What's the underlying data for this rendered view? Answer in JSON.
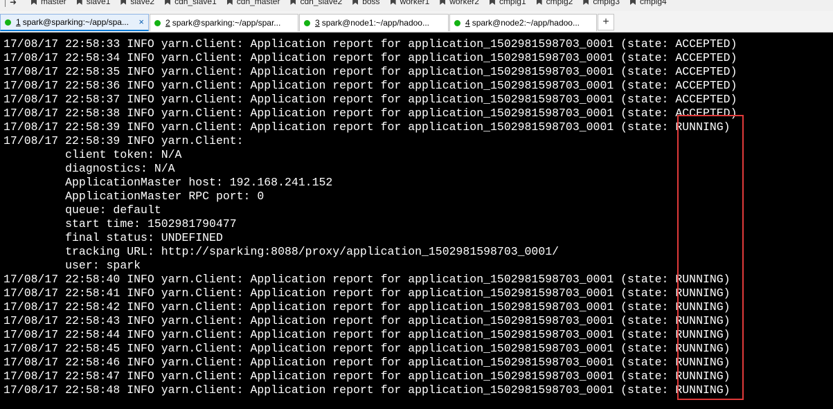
{
  "bookmarks": {
    "items": [
      {
        "label": "master",
        "icon": "bookmark-icon"
      },
      {
        "label": "slave1",
        "icon": "bookmark-icon"
      },
      {
        "label": "slave2",
        "icon": "bookmark-icon"
      },
      {
        "label": "cdh_slave1",
        "icon": "bookmark-icon"
      },
      {
        "label": "cdh_master",
        "icon": "bookmark-icon"
      },
      {
        "label": "cdh_slave2",
        "icon": "bookmark-icon"
      },
      {
        "label": "boss",
        "icon": "bookmark-icon"
      },
      {
        "label": "worker1",
        "icon": "bookmark-icon"
      },
      {
        "label": "worker2",
        "icon": "bookmark-icon"
      },
      {
        "label": "cmpig1",
        "icon": "bookmark-icon"
      },
      {
        "label": "cmpig2",
        "icon": "bookmark-icon"
      },
      {
        "label": "cmpig3",
        "icon": "bookmark-icon"
      },
      {
        "label": "cmpig4",
        "icon": "bookmark-icon"
      }
    ]
  },
  "tabs": [
    {
      "number": "1",
      "title": "spark@sparking:~/app/spa...",
      "active": true,
      "status_color": "#14b314"
    },
    {
      "number": "2",
      "title": "spark@sparking:~/app/spar...",
      "active": false,
      "status_color": "#14b314"
    },
    {
      "number": "3",
      "title": "spark@node1:~/app/hadoo...",
      "active": false,
      "status_color": "#14b314"
    },
    {
      "number": "4",
      "title": "spark@node2:~/app/hadoo...",
      "active": false,
      "status_color": "#14b314"
    }
  ],
  "tab_close_glyph": "×",
  "add_tab_glyph": "+",
  "terminal": {
    "lines": [
      "17/08/17 22:58:33 INFO yarn.Client: Application report for application_1502981598703_0001 (state: ACCEPTED)",
      "17/08/17 22:58:34 INFO yarn.Client: Application report for application_1502981598703_0001 (state: ACCEPTED)",
      "17/08/17 22:58:35 INFO yarn.Client: Application report for application_1502981598703_0001 (state: ACCEPTED)",
      "17/08/17 22:58:36 INFO yarn.Client: Application report for application_1502981598703_0001 (state: ACCEPTED)",
      "17/08/17 22:58:37 INFO yarn.Client: Application report for application_1502981598703_0001 (state: ACCEPTED)",
      "17/08/17 22:58:38 INFO yarn.Client: Application report for application_1502981598703_0001 (state: ACCEPTED)",
      "17/08/17 22:58:39 INFO yarn.Client: Application report for application_1502981598703_0001 (state: RUNNING)",
      "17/08/17 22:58:39 INFO yarn.Client:",
      "\t client token: N/A",
      "\t diagnostics: N/A",
      "\t ApplicationMaster host: 192.168.241.152",
      "\t ApplicationMaster RPC port: 0",
      "\t queue: default",
      "\t start time: 1502981790477",
      "\t final status: UNDEFINED",
      "\t tracking URL: http://sparking:8088/proxy/application_1502981598703_0001/",
      "\t user: spark",
      "17/08/17 22:58:40 INFO yarn.Client: Application report for application_1502981598703_0001 (state: RUNNING)",
      "17/08/17 22:58:41 INFO yarn.Client: Application report for application_1502981598703_0001 (state: RUNNING)",
      "17/08/17 22:58:42 INFO yarn.Client: Application report for application_1502981598703_0001 (state: RUNNING)",
      "17/08/17 22:58:43 INFO yarn.Client: Application report for application_1502981598703_0001 (state: RUNNING)",
      "17/08/17 22:58:44 INFO yarn.Client: Application report for application_1502981598703_0001 (state: RUNNING)",
      "17/08/17 22:58:45 INFO yarn.Client: Application report for application_1502981598703_0001 (state: RUNNING)",
      "17/08/17 22:58:46 INFO yarn.Client: Application report for application_1502981598703_0001 (state: RUNNING)",
      "17/08/17 22:58:47 INFO yarn.Client: Application report for application_1502981598703_0001 (state: RUNNING)",
      "17/08/17 22:58:48 INFO yarn.Client: Application report for application_1502981598703_0001 (state: RUNNING)"
    ],
    "text_color": "#ffffff",
    "background": "#000000",
    "highlight_color": "#e03a3a"
  }
}
